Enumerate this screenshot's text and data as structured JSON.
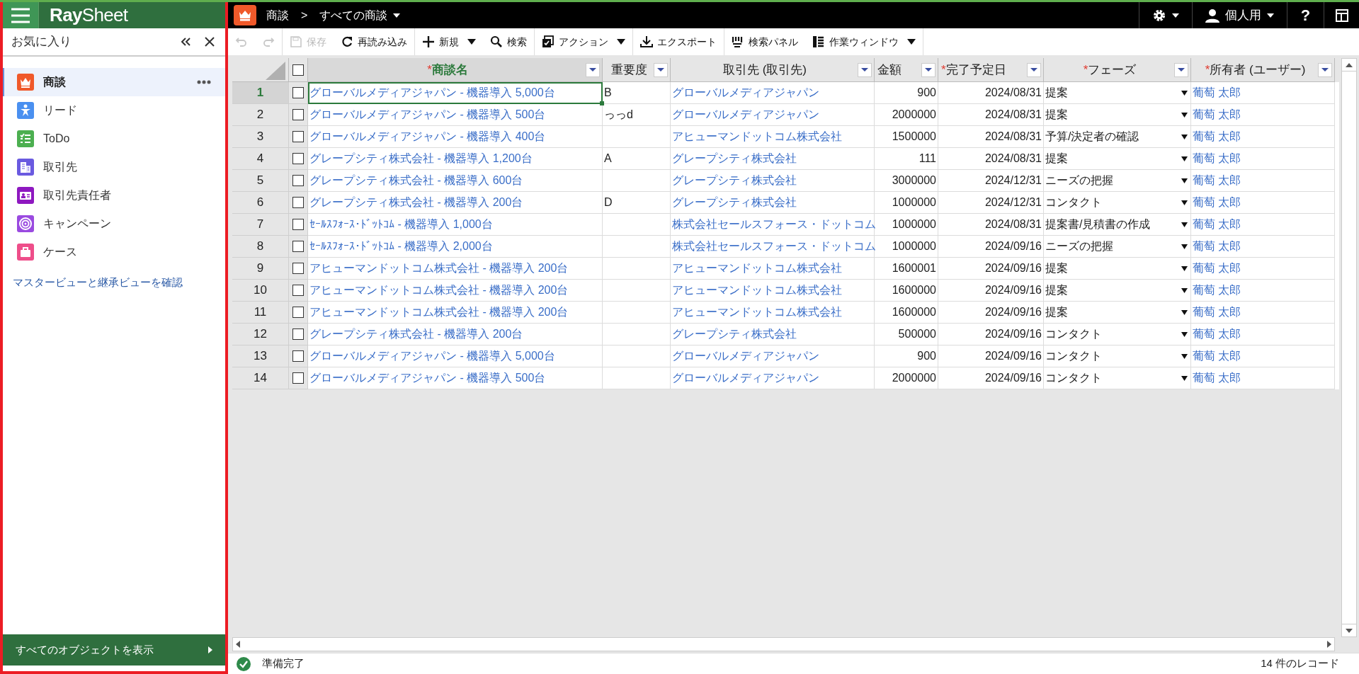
{
  "sidebar": {
    "logo": "**Ray**Sheet",
    "title": "お気に入り",
    "items": [
      {
        "label": "商談",
        "color": "#f0592a",
        "selected": true
      },
      {
        "label": "リード",
        "color": "#4a90f0",
        "selected": false
      },
      {
        "label": "ToDo",
        "color": "#4caf50",
        "selected": false
      },
      {
        "label": "取引先",
        "color": "#6a5ae0",
        "selected": false
      },
      {
        "label": "取引先責任者",
        "color": "#8e18c0",
        "selected": false
      },
      {
        "label": "キャンペーン",
        "color": "#9a4ae0",
        "selected": false
      },
      {
        "label": "ケース",
        "color": "#ee4e8a",
        "selected": false
      }
    ],
    "link": "マスタービューと継承ビューを確認",
    "footer": "すべてのオブジェクトを表示"
  },
  "topbar": {
    "object": "商談",
    "separator": ">",
    "view": "すべての商談",
    "profile": "個人用",
    "help": "?"
  },
  "toolbar": [
    {
      "disabled": true
    },
    {
      "disabled": true
    },
    {
      "label": "保存",
      "disabled": true
    },
    {
      "label": "再読み込み",
      "disabled": false
    },
    {
      "label": "新規",
      "disabled": false
    },
    {
      "label": "検索",
      "disabled": false
    },
    {
      "label": "アクション",
      "disabled": false
    },
    {
      "label": "エクスポート",
      "disabled": false
    },
    {
      "label": "検索パネル",
      "disabled": false
    },
    {
      "label": "作業ウィンドウ",
      "disabled": false
    }
  ],
  "table": {
    "all_checked": false,
    "columns": [
      {
        "label": "商談名",
        "required": "*",
        "kind": "link",
        "active": true
      },
      {
        "label": "重要度",
        "kind": "text",
        "active": false
      },
      {
        "label": "取引先 (取引先)",
        "kind": "link",
        "active": false
      },
      {
        "label": "金額",
        "kind": "number",
        "active": false
      },
      {
        "label": "完了予定日",
        "required": "*",
        "kind": "number",
        "active": false
      },
      {
        "label": "フェーズ",
        "required": "*",
        "kind": "select",
        "active": false
      },
      {
        "label": "所有者 (ユーザー)",
        "required": "*",
        "kind": "link",
        "active": false
      }
    ],
    "rows": [
      {
        "number": "1",
        "active": true,
        "checked": false,
        "cells": [
          "グローバルメディアジャパン - 機器導入 5,000台",
          "B",
          "グローバルメディアジャパン",
          "900",
          "2024/08/31",
          "提案",
          "葡萄 太郎"
        ]
      },
      {
        "number": "2",
        "active": false,
        "checked": false,
        "cells": [
          "グローバルメディアジャパン - 機器導入 500台",
          "っっd",
          "グローバルメディアジャパン",
          "2000000",
          "2024/08/31",
          "提案",
          "葡萄 太郎"
        ]
      },
      {
        "number": "3",
        "active": false,
        "checked": false,
        "cells": [
          "グローバルメディアジャパン - 機器導入 400台",
          "",
          "アヒューマンドットコム株式会社",
          "1500000",
          "2024/08/31",
          "予算/決定者の確認",
          "葡萄 太郎"
        ]
      },
      {
        "number": "4",
        "active": false,
        "checked": false,
        "cells": [
          "グレープシティ株式会社 - 機器導入 1,200台",
          "A",
          "グレープシティ株式会社",
          "111",
          "2024/08/31",
          "提案",
          "葡萄 太郎"
        ]
      },
      {
        "number": "5",
        "active": false,
        "checked": false,
        "cells": [
          "グレープシティ株式会社 - 機器導入 600台",
          "",
          "グレープシティ株式会社",
          "3000000",
          "2024/12/31",
          "ニーズの把握",
          "葡萄 太郎"
        ]
      },
      {
        "number": "6",
        "active": false,
        "checked": false,
        "cells": [
          "グレープシティ株式会社 - 機器導入 200台",
          "D",
          "グレープシティ株式会社",
          "1000000",
          "2024/12/31",
          "コンタクト",
          "葡萄 太郎"
        ]
      },
      {
        "number": "7",
        "active": false,
        "checked": false,
        "cells": [
          "ｾｰﾙｽﾌｫｰｽ･ﾄﾞｯﾄｺﾑ - 機器導入 1,000台",
          "",
          "株式会社セールスフォース・ドットコム",
          "1000000",
          "2024/08/31",
          "提案書/見積書の作成",
          "葡萄 太郎"
        ]
      },
      {
        "number": "8",
        "active": false,
        "checked": false,
        "cells": [
          "ｾｰﾙｽﾌｫｰｽ･ﾄﾞｯﾄｺﾑ - 機器導入 2,000台",
          "",
          "株式会社セールスフォース・ドットコム",
          "1000000",
          "2024/09/16",
          "ニーズの把握",
          "葡萄 太郎"
        ]
      },
      {
        "number": "9",
        "active": false,
        "checked": false,
        "cells": [
          "アヒューマンドットコム株式会社 - 機器導入 200台",
          "",
          "アヒューマンドットコム株式会社",
          "1600001",
          "2024/09/16",
          "提案",
          "葡萄 太郎"
        ]
      },
      {
        "number": "10",
        "active": false,
        "checked": false,
        "cells": [
          "アヒューマンドットコム株式会社 - 機器導入 200台",
          "",
          "アヒューマンドットコム株式会社",
          "1600000",
          "2024/09/16",
          "提案",
          "葡萄 太郎"
        ]
      },
      {
        "number": "11",
        "active": false,
        "checked": false,
        "cells": [
          "アヒューマンドットコム株式会社 - 機器導入 200台",
          "",
          "アヒューマンドットコム株式会社",
          "1600000",
          "2024/09/16",
          "提案",
          "葡萄 太郎"
        ]
      },
      {
        "number": "12",
        "active": false,
        "checked": false,
        "cells": [
          "グレープシティ株式会社 - 機器導入 200台",
          "",
          "グレープシティ株式会社",
          "500000",
          "2024/09/16",
          "コンタクト",
          "葡萄 太郎"
        ]
      },
      {
        "number": "13",
        "active": false,
        "checked": false,
        "cells": [
          "グローバルメディアジャパン - 機器導入 5,000台",
          "",
          "グローバルメディアジャパン",
          "900",
          "2024/09/16",
          "コンタクト",
          "葡萄 太郎"
        ]
      },
      {
        "number": "14",
        "active": false,
        "checked": false,
        "cells": [
          "グローバルメディアジャパン - 機器導入 500台",
          "",
          "グローバルメディアジャパン",
          "2000000",
          "2024/09/16",
          "コンタクト",
          "葡萄 太郎"
        ]
      }
    ]
  },
  "status_bar": {
    "status": "準備完了",
    "count": "14 件のレコード"
  }
}
